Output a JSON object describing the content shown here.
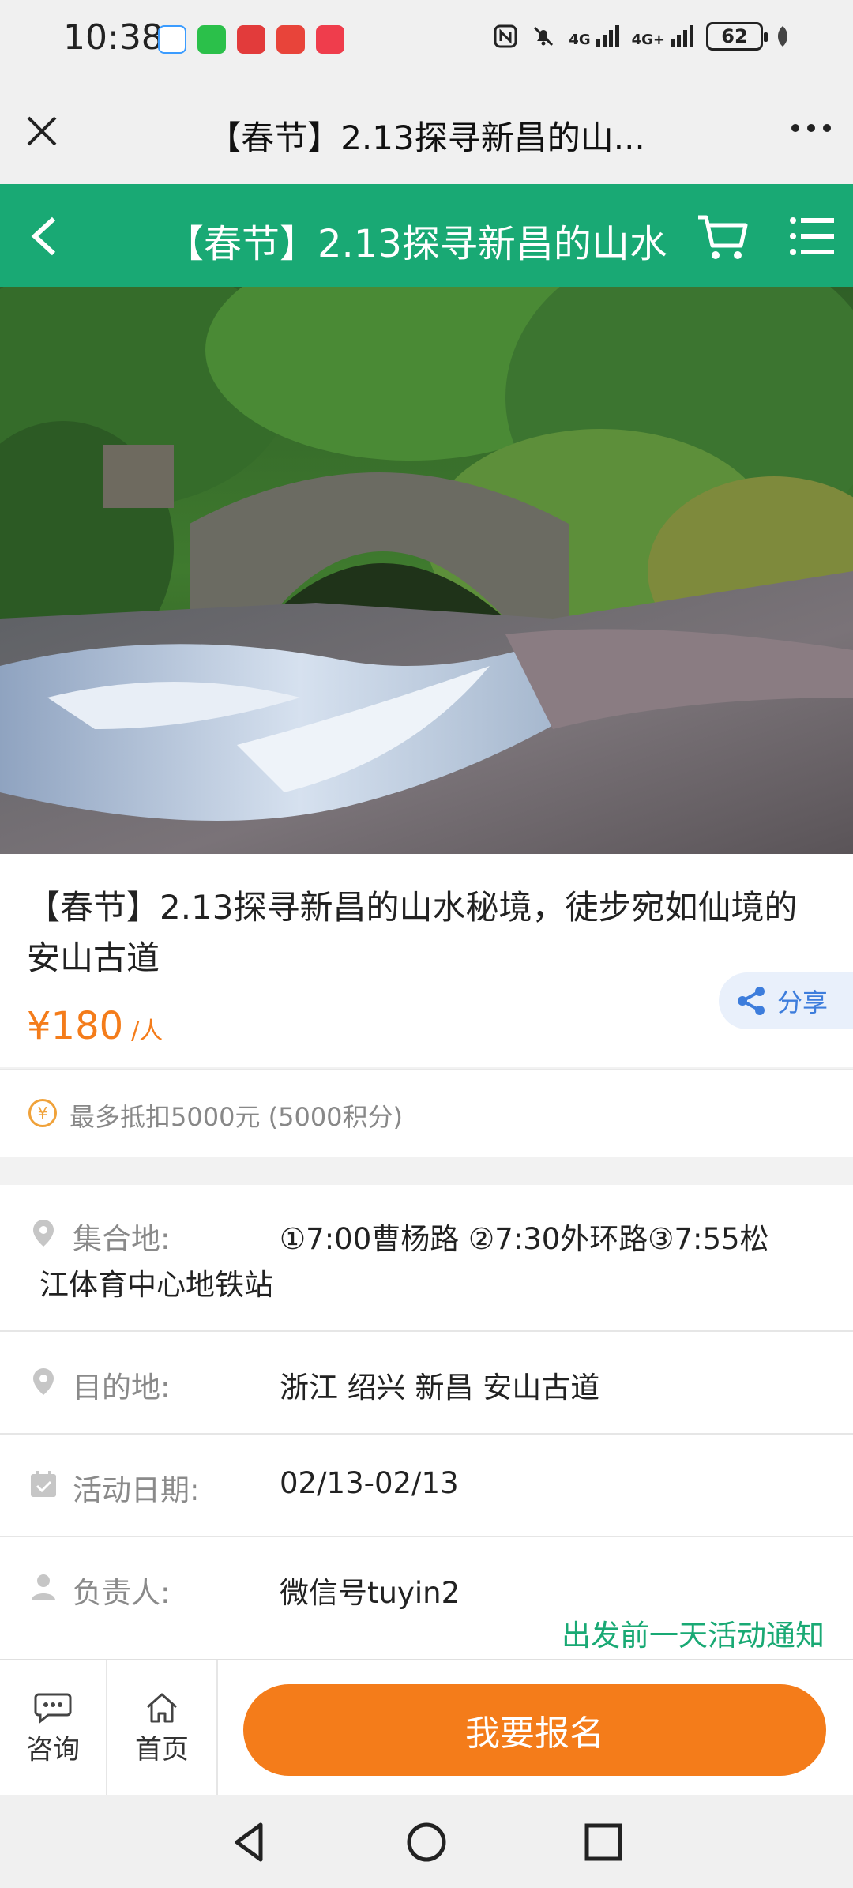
{
  "status_bar": {
    "time": "10:38",
    "network_1": "4G",
    "network_2": "4G+",
    "battery": "62"
  },
  "wechat_bar": {
    "title": "【春节】2.13探寻新昌的山..."
  },
  "header": {
    "title": "【春节】2.13探寻新昌的山水"
  },
  "product": {
    "title": "【春节】2.13探寻新昌的山水秘境，徒步宛如仙境的安山古道",
    "price": "¥180",
    "price_unit": "/人",
    "share_label": "分享"
  },
  "points": {
    "text": "最多抵扣5000元 (5000积分)",
    "icon_char": "¥"
  },
  "details": {
    "meeting_label": "集合地:",
    "meeting_value_line1": "①7:00曹杨路 ②7:30外环路③7:55松",
    "meeting_value_line2": "江体育中心地铁站",
    "destination_label": "目的地:",
    "destination_value": "浙江 绍兴 新昌 安山古道",
    "date_label": "活动日期:",
    "date_value": "02/13-02/13",
    "leader_label": "负责人:",
    "leader_value": "微信号tuyin2",
    "notice": "出发前一天活动通知"
  },
  "bottom": {
    "consult_label": "咨询",
    "home_label": "首页",
    "signup_label": "我要报名"
  },
  "colors": {
    "brand_green": "#19a974",
    "accent_orange": "#f47c1a",
    "share_blue": "#3d7ddc"
  }
}
